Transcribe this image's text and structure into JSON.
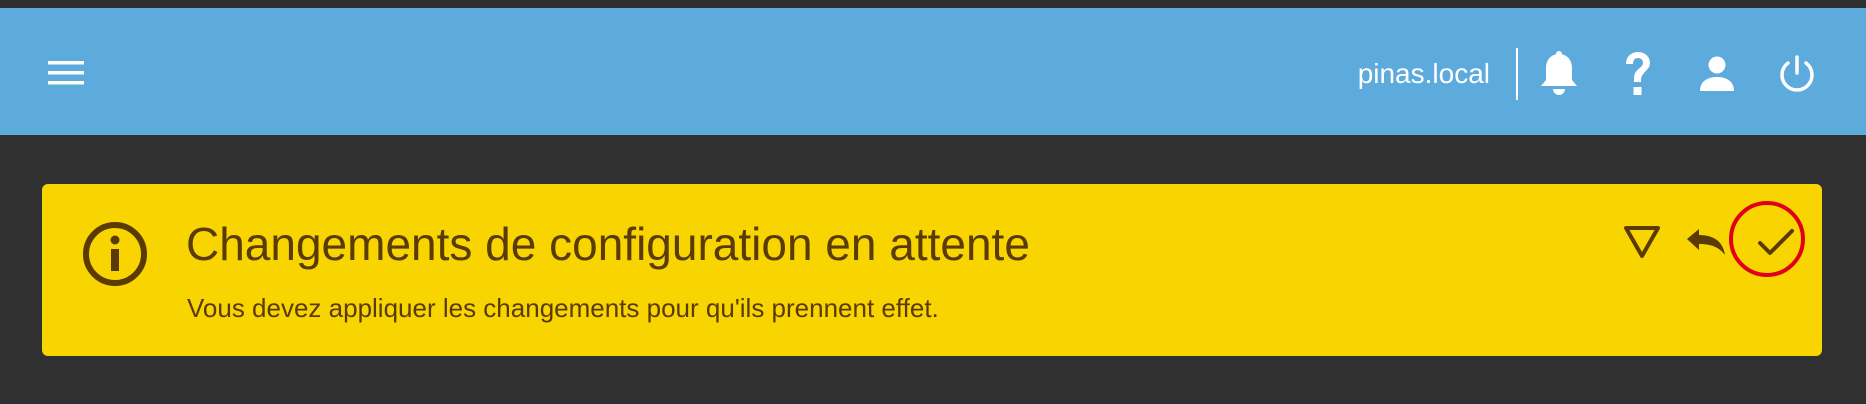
{
  "toolbar": {
    "menu_icon": "menu-icon",
    "hostname": "pinas.local",
    "notifications_icon": "bell-icon",
    "help_icon": "help-icon",
    "user_icon": "user-icon",
    "power_icon": "power-icon"
  },
  "banner": {
    "title": "Changements de configuration en attente",
    "subtitle": "Vous devez appliquer les changements pour qu'ils prennent effet.",
    "info_icon": "info-circle-icon",
    "collapse_icon": "triangle-down-icon",
    "undo_icon": "undo-icon",
    "apply_icon": "check-icon"
  },
  "colors": {
    "toolbar_bg": "#5dabdc",
    "page_bg": "#303030",
    "banner_bg": "#f8d500",
    "banner_text": "#5a3b06",
    "highlight": "#e0001b"
  }
}
